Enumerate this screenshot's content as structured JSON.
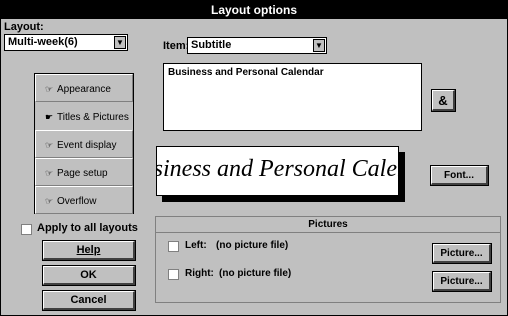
{
  "window": {
    "title": "Layout options"
  },
  "layout": {
    "label": "Layout:",
    "value": "Multi-week(6)"
  },
  "nav": [
    {
      "label": "Appearance",
      "active": false
    },
    {
      "label": "Titles & Pictures",
      "active": true
    },
    {
      "label": "Event display",
      "active": false
    },
    {
      "label": "Page setup",
      "active": false
    },
    {
      "label": "Overflow",
      "active": false
    }
  ],
  "apply_all": {
    "label": "Apply to all layouts"
  },
  "buttons": {
    "help": "Help",
    "ok": "OK",
    "cancel": "Cancel",
    "font": "Font...",
    "amp": "&"
  },
  "item": {
    "label": "Item:",
    "value": "Subtitle"
  },
  "text_value": "Business and Personal Calendar",
  "preview_text": "Business and Personal Calendar",
  "pictures": {
    "header": "Pictures",
    "left": {
      "label": "Left:",
      "value": "(no picture file)",
      "button": "Picture..."
    },
    "right": {
      "label": "Right:",
      "value": "(no picture file)",
      "button": "Picture..."
    }
  }
}
